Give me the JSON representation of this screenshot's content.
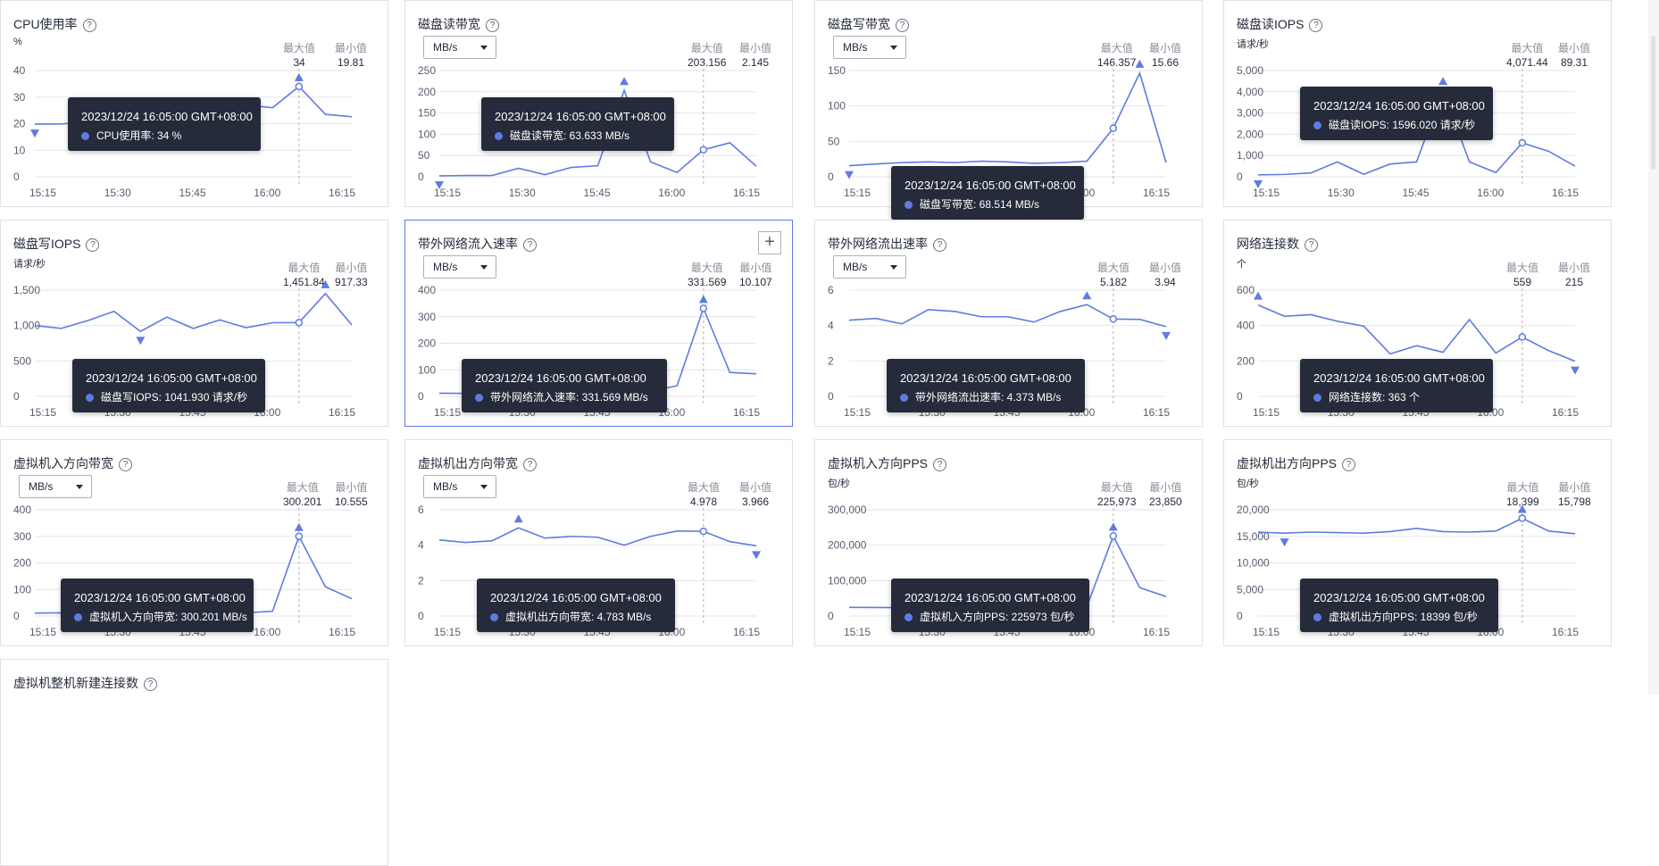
{
  "colors": {
    "line": "#5e7ce0",
    "grid": "#e4e6ea",
    "tooltip_bg": "#252b3a",
    "active_border": "#5e7ce0"
  },
  "labels": {
    "max": "最大值",
    "min": "最小值"
  },
  "cards": [
    {
      "title": "CPU使用率",
      "unit_text": "%",
      "max": "34",
      "min": "19.81",
      "tooltip": {
        "time": "2023/12/24 16:05:00 GMT+08:00",
        "text": "CPU使用率: 34 %"
      },
      "chart_data": {
        "type": "line",
        "x": [
          "15:15",
          "15:30",
          "15:45",
          "16:00",
          "16:15"
        ],
        "y_ticks": [
          "40",
          "30",
          "20",
          "10",
          "0"
        ],
        "ylim": [
          0,
          40
        ],
        "values": [
          19.81,
          19.9,
          20.5,
          22.0,
          23.5,
          24.5,
          26.0,
          29.0,
          27.0,
          26.0,
          34.0,
          23.5,
          22.6
        ],
        "max_idx": 10,
        "min_idx": 0,
        "hover_idx": 10
      }
    },
    {
      "title": "磁盘读带宽",
      "unit_select": "MB/s",
      "max": "203.156",
      "min": "2.145",
      "tooltip": {
        "time": "2023/12/24 16:05:00 GMT+08:00",
        "text": "磁盘读带宽: 63.633 MB/s"
      },
      "chart_data": {
        "type": "line",
        "x": [
          "15:15",
          "15:30",
          "15:45",
          "16:00",
          "16:15"
        ],
        "y_ticks": [
          "250",
          "200",
          "150",
          "100",
          "50",
          "0"
        ],
        "ylim": [
          0,
          250
        ],
        "values": [
          2.145,
          3,
          3,
          20,
          5,
          22,
          26,
          203.156,
          35,
          10,
          63.633,
          80,
          25
        ],
        "max_idx": 7,
        "min_idx": 0,
        "hover_idx": 10
      }
    },
    {
      "title": "磁盘写带宽",
      "unit_select": "MB/s",
      "max": "146.357",
      "min": "15.66",
      "tooltip": {
        "time": "2023/12/24 16:05:00 GMT+08:00",
        "text": "磁盘写带宽: 68.514 MB/s"
      },
      "chart_data": {
        "type": "line",
        "x": [
          "15:15",
          "15:30",
          "15:45",
          "16:00",
          "16:15"
        ],
        "y_ticks": [
          "150",
          "100",
          "50",
          "0"
        ],
        "ylim": [
          0,
          150
        ],
        "values": [
          15.66,
          18,
          20,
          21,
          20,
          22,
          21,
          19,
          20,
          22,
          68.514,
          146.357,
          20
        ],
        "max_idx": 11,
        "min_idx": 0,
        "hover_idx": 10
      }
    },
    {
      "title": "磁盘读IOPS",
      "unit_text": "请求/秒",
      "max": "4,071.44",
      "min": "89.31",
      "tooltip": {
        "time": "2023/12/24 16:05:00 GMT+08:00",
        "text": "磁盘读IOPS: 1596.020 请求/秒"
      },
      "chart_data": {
        "type": "line",
        "x": [
          "15:15",
          "15:30",
          "15:45",
          "16:00",
          "16:15"
        ],
        "y_ticks": [
          "5,000",
          "4,000",
          "3,000",
          "2,000",
          "1,000",
          "0"
        ],
        "ylim": [
          0,
          5000
        ],
        "values": [
          89.31,
          110,
          180,
          700,
          120,
          600,
          700,
          4071.44,
          700,
          200,
          1596.02,
          1200,
          500
        ],
        "max_idx": 7,
        "min_idx": 0,
        "hover_idx": 10
      }
    },
    {
      "title": "磁盘写IOPS",
      "unit_text": "请求/秒",
      "max": "1,451.84",
      "min": "917.33",
      "tooltip": {
        "time": "2023/12/24 16:05:00 GMT+08:00",
        "text": "磁盘写IOPS: 1041.930 请求/秒"
      },
      "chart_data": {
        "type": "line",
        "x": [
          "15:15",
          "15:30",
          "15:45",
          "16:00",
          "16:15"
        ],
        "y_ticks": [
          "1,500",
          "1,000",
          "500",
          "0"
        ],
        "ylim": [
          0,
          1500
        ],
        "values": [
          1000,
          960,
          1070,
          1200,
          917.33,
          1120,
          960,
          1080,
          970,
          1040,
          1041.93,
          1451.84,
          1010
        ],
        "max_idx": 11,
        "min_idx": 4,
        "hover_idx": 10
      }
    },
    {
      "title": "带外网络流入速率",
      "unit_select": "MB/s",
      "max": "331.569",
      "min": "10.107",
      "active": true,
      "add_button": "+",
      "tooltip": {
        "time": "2023/12/24 16:05:00 GMT+08:00",
        "text": "带外网络流入速率: 331.569 MB/s"
      },
      "chart_data": {
        "type": "line",
        "x": [
          "15:15",
          "15:30",
          "15:45",
          "16:00",
          "16:15"
        ],
        "y_ticks": [
          "400",
          "300",
          "200",
          "100",
          "0"
        ],
        "ylim": [
          0,
          400
        ],
        "values": [
          12,
          11,
          10.107,
          30,
          15,
          25,
          90,
          40,
          20,
          40,
          331.569,
          90,
          85
        ],
        "max_idx": 10,
        "min_idx": 2,
        "hover_idx": 10
      }
    },
    {
      "title": "带外网络流出速率",
      "unit_select": "MB/s",
      "max": "5.182",
      "min": "3.94",
      "tooltip": {
        "time": "2023/12/24 16:05:00 GMT+08:00",
        "text": "带外网络流出速率: 4.373 MB/s"
      },
      "chart_data": {
        "type": "line",
        "x": [
          "15:15",
          "15:30",
          "15:45",
          "16:00",
          "16:15"
        ],
        "y_ticks": [
          "6",
          "4",
          "2",
          "0"
        ],
        "ylim": [
          0,
          6
        ],
        "values": [
          4.3,
          4.4,
          4.1,
          4.9,
          4.8,
          4.5,
          4.5,
          4.2,
          4.8,
          5.182,
          4.373,
          4.35,
          3.94
        ],
        "max_idx": 9,
        "min_idx": 12,
        "hover_idx": 10
      }
    },
    {
      "title": "网络连接数",
      "unit_text": "个",
      "max": "559",
      "min": "215",
      "tooltip": {
        "time": "2023/12/24 16:05:00 GMT+08:00",
        "text": "网络连接数: 363 个"
      },
      "chart_data": {
        "type": "line",
        "x": [
          "15:15",
          "15:30",
          "15:45",
          "16:00",
          "16:15"
        ],
        "y_ticks": [
          "600",
          "400",
          "200",
          "0"
        ],
        "ylim": [
          0,
          650
        ],
        "values": [
          559,
          490,
          500,
          460,
          430,
          260,
          310,
          270,
          470,
          265,
          363,
          280,
          215
        ],
        "max_idx": 0,
        "min_idx": 12,
        "hover_idx": 10
      }
    },
    {
      "title": "虚拟机入方向带宽",
      "unit_select": "MB/s",
      "max": "300.201",
      "min": "10.555",
      "tooltip": {
        "time": "2023/12/24 16:05:00 GMT+08:00",
        "text": "虚拟机入方向带宽: 300.201 MB/s"
      },
      "chart_data": {
        "type": "line",
        "x": [
          "15:15",
          "15:30",
          "15:45",
          "16:00",
          "16:15"
        ],
        "y_ticks": [
          "400",
          "300",
          "200",
          "100",
          "0"
        ],
        "ylim": [
          0,
          400
        ],
        "values": [
          11,
          12,
          10.555,
          13,
          12,
          12,
          14,
          13,
          12,
          18,
          300.201,
          110,
          65
        ],
        "max_idx": 10,
        "min_idx": 2,
        "hover_idx": 10
      }
    },
    {
      "title": "虚拟机出方向带宽",
      "unit_select": "MB/s",
      "max": "4.978",
      "min": "3.966",
      "tooltip": {
        "time": "2023/12/24 16:05:00 GMT+08:00",
        "text": "虚拟机出方向带宽: 4.783 MB/s"
      },
      "chart_data": {
        "type": "line",
        "x": [
          "15:15",
          "15:30",
          "15:45",
          "16:00",
          "16:15"
        ],
        "y_ticks": [
          "6",
          "4",
          "2",
          "0"
        ],
        "ylim": [
          0,
          6
        ],
        "values": [
          4.3,
          4.15,
          4.25,
          4.978,
          4.4,
          4.5,
          4.45,
          4.0,
          4.5,
          4.8,
          4.783,
          4.2,
          3.966
        ],
        "max_idx": 3,
        "min_idx": 12,
        "hover_idx": 10
      }
    },
    {
      "title": "虚拟机入方向PPS",
      "unit_text": "包/秒",
      "max": "225,973",
      "min": "23,850",
      "tooltip": {
        "time": "2023/12/24 16:05:00 GMT+08:00",
        "text": "虚拟机入方向PPS: 225973 包/秒"
      },
      "chart_data": {
        "type": "line",
        "x": [
          "15:15",
          "15:30",
          "15:45",
          "16:00",
          "16:15"
        ],
        "y_ticks": [
          "300,000",
          "200,000",
          "100,000",
          "0"
        ],
        "ylim": [
          0,
          300000
        ],
        "values": [
          24500,
          24000,
          23850,
          26000,
          25000,
          24500,
          26000,
          25000,
          24000,
          27000,
          225973,
          80000,
          55000
        ],
        "max_idx": 10,
        "min_idx": 2,
        "hover_idx": 10
      }
    },
    {
      "title": "虚拟机出方向PPS",
      "unit_text": "包/秒",
      "max": "18,399",
      "min": "15,798",
      "tooltip": {
        "time": "2023/12/24 16:05:00 GMT+08:00",
        "text": "虚拟机出方向PPS: 18399 包/秒"
      },
      "chart_data": {
        "type": "line",
        "x": [
          "15:15",
          "15:30",
          "15:45",
          "16:00",
          "16:15"
        ],
        "y_ticks": [
          "20,000",
          "15,000",
          "10,000",
          "5,000",
          "0"
        ],
        "ylim": [
          0,
          20000
        ],
        "values": [
          15798,
          15600,
          15800,
          15700,
          15600,
          15900,
          16500,
          15900,
          15800,
          16000,
          18399,
          16000,
          15500
        ],
        "max_idx": 10,
        "min_idx": 1,
        "hover_idx": 10
      }
    },
    {
      "title": "虚拟机整机新建连接数"
    }
  ]
}
